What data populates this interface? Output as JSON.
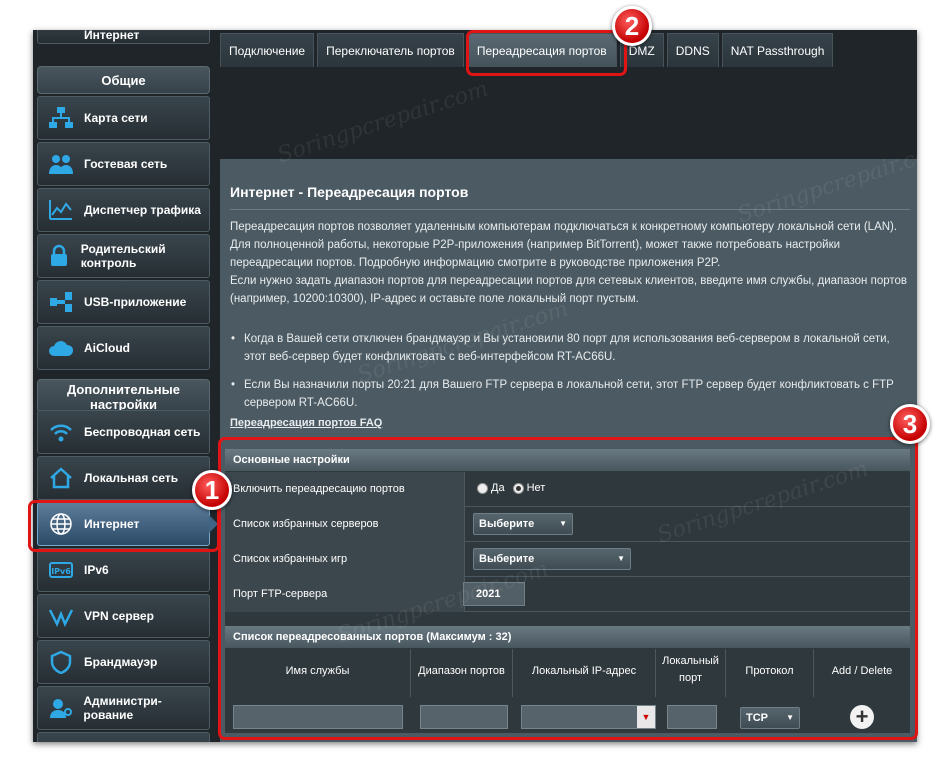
{
  "sidebar": {
    "top_partial": "Интернет",
    "general_header": "Общие",
    "general_items": [
      {
        "label": "Карта сети",
        "icon": "network-map-icon"
      },
      {
        "label": "Гостевая сеть",
        "icon": "guest-network-icon"
      },
      {
        "label": "Диспетчер трафика",
        "icon": "traffic-manager-icon"
      },
      {
        "label": "Родительский контроль",
        "icon": "parental-lock-icon"
      },
      {
        "label": "USB-приложение",
        "icon": "usb-icon"
      },
      {
        "label": "AiCloud",
        "icon": "cloud-icon"
      }
    ],
    "advanced_header": "Дополнительные настройки",
    "advanced_items": [
      {
        "label": "Беспроводная сеть",
        "icon": "wifi-icon"
      },
      {
        "label": "Локальная сеть",
        "icon": "home-icon"
      },
      {
        "label": "Интернет",
        "icon": "globe-icon",
        "active": true
      },
      {
        "label": "IPv6",
        "icon": "ipv6-icon"
      },
      {
        "label": "VPN сервер",
        "icon": "vpn-icon"
      },
      {
        "label": "Брандмауэр",
        "icon": "shield-icon"
      },
      {
        "label": "Администри-рование",
        "icon": "admin-icon"
      }
    ]
  },
  "tabs": [
    {
      "label": "Подключение"
    },
    {
      "label": "Переключатель портов"
    },
    {
      "label": "Переадресация портов",
      "active": true
    },
    {
      "label": "DMZ"
    },
    {
      "label": "DDNS"
    },
    {
      "label": "NAT Passthrough"
    }
  ],
  "content": {
    "title": "Интернет - Переадресация портов",
    "desc_p1": "Переадресация портов позволяет удаленным компьютерам подключаться к конкретному компьютеру локальной сети (LAN). Для полноценной работы, некоторые P2P-приложения (например BitTorrent), может также потребовать настройки переадресации портов. Подробную информацию смотрите в руководстве приложения P2P.",
    "desc_p2": "Если нужно задать диапазон портов для переадресации портов для сетевых клиентов, введите имя службы, диапазон портов (например, 10200:10300), IP-адрес и оставьте поле локальный порт пустым.",
    "bullet1": "Когда в Вашей сети отключен брандмауэр и Вы установили 80 порт для использования веб-сервером в локальной сети, этот веб-сервер будет конфликтовать с веб-интерфейсом RT-AC66U.",
    "bullet2": "Если Вы назначили порты 20:21 для Вашего FTP сервера в локальной сети, этот FTP сервер будет конфликтовать с FTP сервером RT-AC66U.",
    "faq_link": "Переадресация портов FAQ"
  },
  "basic": {
    "header": "Основные настройки",
    "enable_label": "Включить переадресацию портов",
    "yes": "Да",
    "no": "Нет",
    "enabled": false,
    "servers_label": "Список избранных серверов",
    "servers_value": "Выберите",
    "games_label": "Список избранных игр",
    "games_value": "Выберите",
    "ftp_label": "Порт FTP-сервера",
    "ftp_value": "2021"
  },
  "list": {
    "header": "Список переадресованных портов (Максимум : 32)",
    "col_service": "Имя службы",
    "col_range": "Диапазон портов",
    "col_ip": "Локальный IP-адрес",
    "col_local_port": "Локальный порт",
    "col_protocol": "Протокол",
    "col_add_delete": "Add / Delete",
    "protocol_value": "TCP"
  },
  "annotations": [
    "1",
    "2",
    "3"
  ],
  "colors": {
    "accent_red": "#e01414",
    "panel": "#4c5b63"
  }
}
